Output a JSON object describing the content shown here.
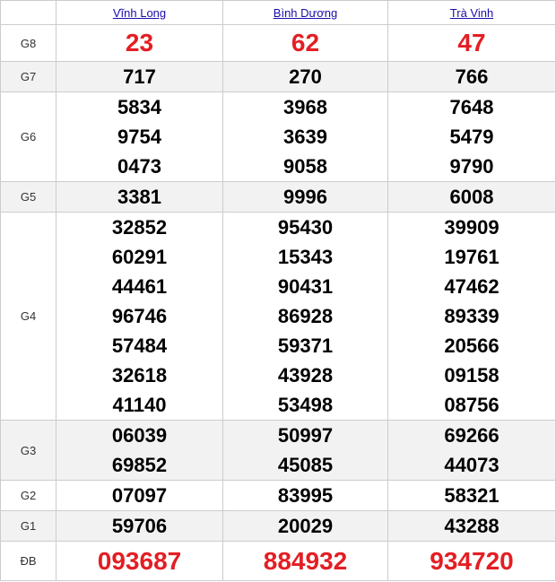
{
  "provinces": [
    "Vĩnh Long",
    "Bình Dương",
    "Trà Vinh"
  ],
  "colors": {
    "prize_red": "#e31e24",
    "link_blue": "#1a0dab",
    "alt_row": "#f2f2f2",
    "border": "#cccccc"
  },
  "prizes": {
    "g8": {
      "label": "G8",
      "values": [
        [
          "23"
        ],
        [
          "62"
        ],
        [
          "47"
        ]
      ]
    },
    "g7": {
      "label": "G7",
      "values": [
        [
          "717"
        ],
        [
          "270"
        ],
        [
          "766"
        ]
      ]
    },
    "g6": {
      "label": "G6",
      "values": [
        [
          "5834",
          "9754",
          "0473"
        ],
        [
          "3968",
          "3639",
          "9058"
        ],
        [
          "7648",
          "5479",
          "9790"
        ]
      ]
    },
    "g5": {
      "label": "G5",
      "values": [
        [
          "3381"
        ],
        [
          "9996"
        ],
        [
          "6008"
        ]
      ]
    },
    "g4": {
      "label": "G4",
      "values": [
        [
          "32852",
          "60291",
          "44461",
          "96746",
          "57484",
          "32618",
          "41140"
        ],
        [
          "95430",
          "15343",
          "90431",
          "86928",
          "59371",
          "43928",
          "53498"
        ],
        [
          "39909",
          "19761",
          "47462",
          "89339",
          "20566",
          "09158",
          "08756"
        ]
      ]
    },
    "g3": {
      "label": "G3",
      "values": [
        [
          "06039",
          "69852"
        ],
        [
          "50997",
          "45085"
        ],
        [
          "69266",
          "44073"
        ]
      ]
    },
    "g2": {
      "label": "G2",
      "values": [
        [
          "07097"
        ],
        [
          "83995"
        ],
        [
          "58321"
        ]
      ]
    },
    "g1": {
      "label": "G1",
      "values": [
        [
          "59706"
        ],
        [
          "20029"
        ],
        [
          "43288"
        ]
      ]
    },
    "db": {
      "label": "ĐB",
      "values": [
        [
          "093687"
        ],
        [
          "884932"
        ],
        [
          "934720"
        ]
      ]
    }
  }
}
